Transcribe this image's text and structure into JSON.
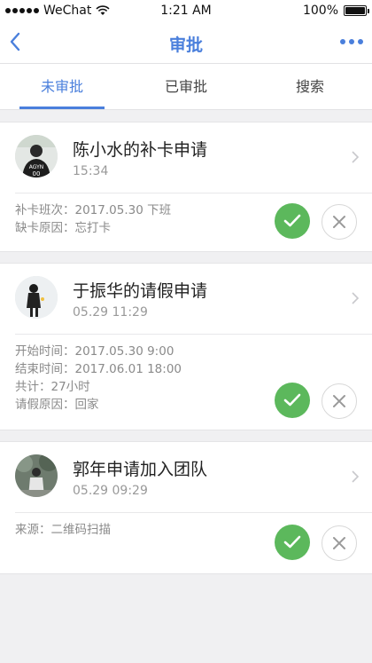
{
  "status_bar": {
    "carrier": "WeChat",
    "time": "1:21 AM",
    "battery": "100%",
    "battery_level": 1.0
  },
  "nav": {
    "title": "审批",
    "back_icon": "chevron-left-icon",
    "more_icon": "more-dots-icon"
  },
  "tabs": [
    {
      "label": "未审批",
      "active": true
    },
    {
      "label": "已审批",
      "active": false
    },
    {
      "label": "搜索",
      "active": false
    }
  ],
  "colors": {
    "accent": "#4a7fdc",
    "approve": "#5cb85c",
    "background": "#f0f0f2"
  },
  "approvals": [
    {
      "title": "陈小水的补卡申请",
      "time": "15:34",
      "details": [
        {
          "label": "补卡班次：",
          "value": "2017.05.30 下班"
        },
        {
          "label": "缺卡原因：",
          "value": "忘打卡"
        }
      ]
    },
    {
      "title": "于振华的请假申请",
      "time": "05.29 11:29",
      "details": [
        {
          "label": "开始时间：",
          "value": "2017.05.30 9:00"
        },
        {
          "label": "结束时间：",
          "value": "2017.06.01 18:00"
        },
        {
          "label": "共计：",
          "value": "27小时"
        },
        {
          "label": "请假原因：",
          "value": "回家"
        }
      ]
    },
    {
      "title": "郭年申请加入团队",
      "time": "05.29 09:29",
      "details": [
        {
          "label": "来源：",
          "value": "二维码扫描"
        }
      ]
    }
  ]
}
